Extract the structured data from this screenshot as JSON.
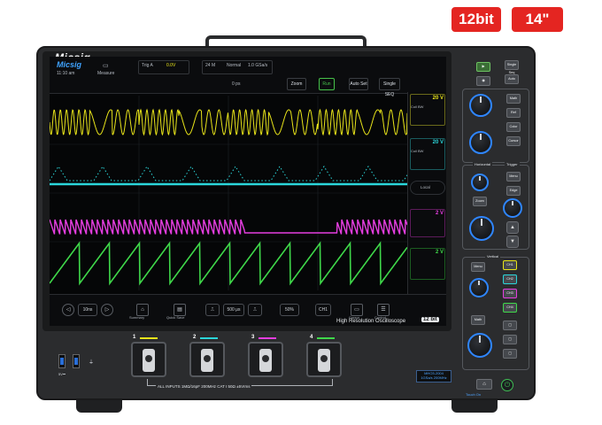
{
  "badges": {
    "resolution": "12bit",
    "size": "14\""
  },
  "brand": "Micsig",
  "screen": {
    "logo": "Micsig",
    "timestamp": "11:10 am",
    "measure_label": "Measure",
    "trigger_label": "Trig A",
    "trigger_value": "0.0V",
    "memory_label": "24 M",
    "mode_label": "Normal",
    "rate_label": "1.0 GSa/s",
    "time_offset": "0 ps",
    "buttons": {
      "zoom": "Zoom",
      "run": "Run",
      "auto_set": "Auto Set",
      "single_seq": "Single SEQ"
    },
    "channels": [
      {
        "label": "20 V",
        "color": "#e8e41a"
      },
      {
        "label": "20 V",
        "color": "#2bd6da"
      },
      {
        "label": "2 V",
        "color": "#e53ee0"
      },
      {
        "label": "2 V",
        "color": "#3fd84a"
      }
    ],
    "channel_panel": {
      "local_label": "Local"
    },
    "bottom": {
      "timebase": "10ns",
      "summary_label": "Summary",
      "quick_save_label": "Quick Save",
      "div_value": "500 μs",
      "percent_value": "50%",
      "cursor_value": "CH1",
      "cursor_label": "Cursor",
      "control_label": "Control"
    }
  },
  "caption": {
    "text": "High Resolution Oscilloscope",
    "badge": "12 bit"
  },
  "front": {
    "usb_label": "5V⎓",
    "input_labels": [
      "1",
      "2",
      "3",
      "4"
    ],
    "input_colors": [
      "#e8e41a",
      "#2bd6da",
      "#e53ee0",
      "#3fd84a"
    ],
    "inputs_text": "ALL INPUTS 1MΩ/16pF 200MHz CAT I    50Ω ±5Vrms",
    "model_line1": "MHO3-2004",
    "model_line2": "1GSa/s  200MHz"
  },
  "panel": {
    "top_buttons": [
      "Single Seq",
      "Auto"
    ],
    "vertical_buttons": [
      "Math",
      "Ref",
      "Color",
      "Cursor"
    ],
    "horizontal_title": "Horizontal",
    "trigger_title": "Trigger",
    "horizontal_buttons": [
      "Position",
      "Zoom"
    ],
    "trigger_buttons": [
      "Menu",
      "Edge",
      "Level"
    ],
    "trig_level_label": "Level",
    "scale_label": "Scale",
    "vertical_title": "Vertical",
    "ch_buttons": [
      "Menu",
      "CH1",
      "CH2",
      "CH3",
      "CH4"
    ],
    "position_label": "Position",
    "math_label": "Math",
    "scale2_label": "Scale",
    "home_label": "⌂",
    "touch_label": "Touch On"
  }
}
